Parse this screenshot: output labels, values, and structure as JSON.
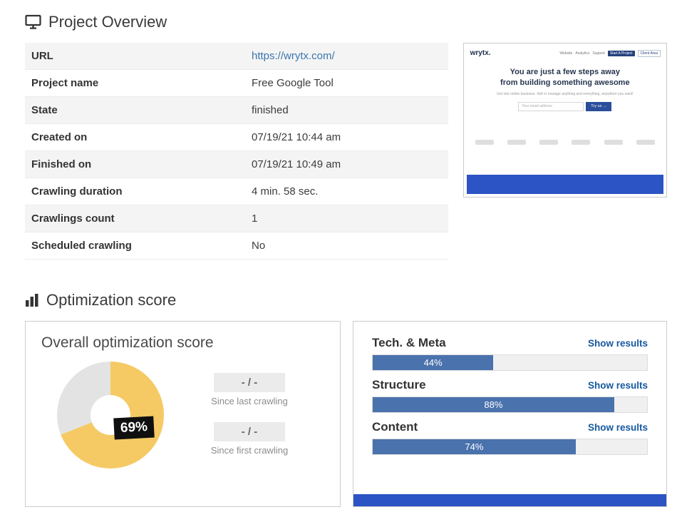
{
  "colors": {
    "donut_fill": "#f5ca64",
    "donut_rest": "#e3e3e3",
    "bar_fill": "#4a72ad",
    "link_blue": "#3a76ad",
    "show_results_blue": "#15599f",
    "badge_bg": "#0f0f0f",
    "footer_blue": "#2c54c4"
  },
  "project_overview": {
    "title": "Project Overview",
    "rows": [
      {
        "label": "URL",
        "value": "https://wrytx.com/"
      },
      {
        "label": "Project name",
        "value": "Free Google Tool"
      },
      {
        "label": "State",
        "value": "finished"
      },
      {
        "label": "Created on",
        "value": "07/19/21 10:44 am"
      },
      {
        "label": "Finished on",
        "value": "07/19/21 10:49 am"
      },
      {
        "label": "Crawling duration",
        "value": "4 min. 58 sec."
      },
      {
        "label": "Crawlings count",
        "value": "1"
      },
      {
        "label": "Scheduled crawling",
        "value": "No"
      }
    ]
  },
  "thumbnail": {
    "logo": "wrytx.",
    "nav": [
      "Website",
      "Analytics",
      "Support"
    ],
    "nav_buttons": [
      "Start A Project",
      "Client Area"
    ],
    "hero_line1": "You are just a few steps away",
    "hero_line2": "from building something awesome",
    "hero_sub": "Get into online business. Sell or manage anything and everything, anywhere you want!",
    "email_placeholder": "Your email address",
    "cta": "Try us →"
  },
  "optimization": {
    "title": "Optimization score",
    "overall": {
      "title": "Overall optimization score",
      "score": 69,
      "score_label": "69%",
      "since_last": {
        "value": "- / -",
        "caption": "Since last crawling"
      },
      "since_first": {
        "value": "- / -",
        "caption": "Since first crawling"
      }
    },
    "bars": [
      {
        "label": "Tech. & Meta",
        "link": "Show results",
        "percent": 44,
        "percent_label": "44%"
      },
      {
        "label": "Structure",
        "link": "Show results",
        "percent": 88,
        "percent_label": "88%"
      },
      {
        "label": "Content",
        "link": "Show results",
        "percent": 74,
        "percent_label": "74%"
      }
    ]
  },
  "chart_data": [
    {
      "type": "pie",
      "title": "Overall optimization score",
      "labels": [
        "score",
        "remaining"
      ],
      "values": [
        69,
        31
      ],
      "center_label": "69%"
    },
    {
      "type": "bar",
      "categories": [
        "Tech. & Meta",
        "Structure",
        "Content"
      ],
      "values": [
        44,
        88,
        74
      ],
      "unit": "%",
      "xlim": [
        0,
        100
      ]
    }
  ]
}
